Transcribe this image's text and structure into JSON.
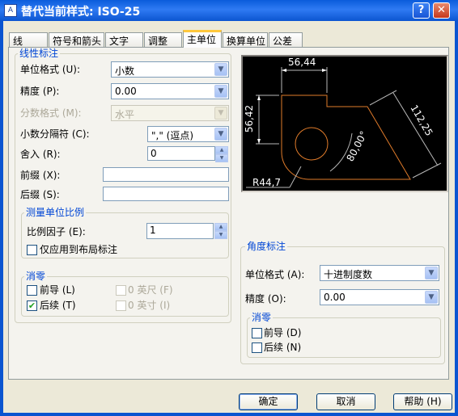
{
  "window": {
    "icon": "dimstyle-icon",
    "title": "替代当前样式: ISO-25",
    "help_btn": "?",
    "close_btn": "✕"
  },
  "tabs": [
    {
      "label": "线"
    },
    {
      "label": "符号和箭头"
    },
    {
      "label": "文字"
    },
    {
      "label": "调整"
    },
    {
      "label": "主单位"
    },
    {
      "label": "换算单位"
    },
    {
      "label": "公差"
    }
  ],
  "active_tab": "主单位",
  "linear": {
    "title": "线性标注",
    "unit_format": {
      "label": "单位格式 (U):",
      "value": "小数"
    },
    "precision": {
      "label": "精度 (P):",
      "value": "0.00"
    },
    "fraction_format": {
      "label": "分数格式 (M):",
      "value": "水平",
      "disabled": true
    },
    "decimal_separator": {
      "label": "小数分隔符 (C):",
      "value": "\",\"  (逗点)"
    },
    "round_off": {
      "label": "舍入 (R):",
      "value": "0"
    },
    "prefix": {
      "label": "前缀 (X):",
      "value": ""
    },
    "suffix": {
      "label": "后缀 (S):",
      "value": ""
    }
  },
  "scale": {
    "title": "测量单位比例",
    "factor": {
      "label": "比例因子 (E):",
      "value": "1"
    },
    "layout_only": {
      "label": "仅应用到布局标注",
      "checked": false
    }
  },
  "zero_linear": {
    "title": "消零",
    "leading": {
      "label": "前导 (L)",
      "checked": false
    },
    "trailing": {
      "label": "后续 (T)",
      "checked": true
    },
    "feet": {
      "label": "0 英尺 (F)",
      "checked": false,
      "disabled": true
    },
    "inches": {
      "label": "0 英寸 (I)",
      "checked": false,
      "disabled": true
    }
  },
  "preview": {
    "dim_top": "56,44",
    "dim_left": "56,42",
    "dim_right": "112,25",
    "dim_angle": "80,00°",
    "dim_radius": "R44,7"
  },
  "angular": {
    "title": "角度标注",
    "unit_format": {
      "label": "单位格式 (A):",
      "value": "十进制度数"
    },
    "precision": {
      "label": "精度 (O):",
      "value": "0.00"
    },
    "zero": {
      "title": "消零",
      "leading": {
        "label": "前导 (D)",
        "checked": false
      },
      "trailing": {
        "label": "后续 (N)",
        "checked": false
      }
    }
  },
  "buttons": {
    "ok": "确定",
    "cancel": "取消",
    "help": "帮助 (H)"
  },
  "glyphs": {
    "dropdown": "▼",
    "up": "▲",
    "down": "▼",
    "check": "✔"
  }
}
